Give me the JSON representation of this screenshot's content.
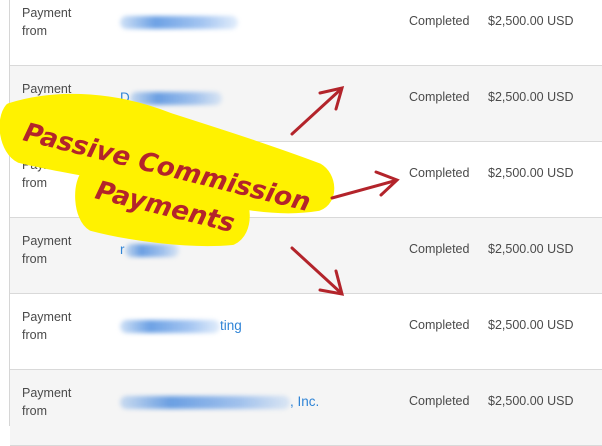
{
  "transactions": [
    {
      "type_line1": "Payment",
      "type_line2": "from",
      "name_visible": "",
      "status": "Completed",
      "amount": "$2,500.00 USD"
    },
    {
      "type_line1": "Payment",
      "type_line2": "from",
      "name_visible": "D",
      "status": "Completed",
      "amount": "$2,500.00 USD"
    },
    {
      "type_line1": "Payment",
      "type_line2": "from",
      "name_visible": "",
      "status": "Completed",
      "amount": "$2,500.00 USD"
    },
    {
      "type_line1": "Payment",
      "type_line2": "from",
      "name_visible": "r",
      "status": "Completed",
      "amount": "$2,500.00 USD"
    },
    {
      "type_line1": "Payment",
      "type_line2": "from",
      "name_visible": "ting",
      "status": "Completed",
      "amount": "$2,500.00 USD"
    },
    {
      "type_line1": "Payment",
      "type_line2": "from",
      "name_visible": ", Inc.",
      "status": "Completed",
      "amount": "$2,500.00 USD"
    }
  ],
  "annotation": {
    "line1": "Passive Commission",
    "line2": "Payments"
  },
  "colors": {
    "link": "#2f84d6",
    "highlighter": "#fff200",
    "marker": "#b3242b"
  }
}
